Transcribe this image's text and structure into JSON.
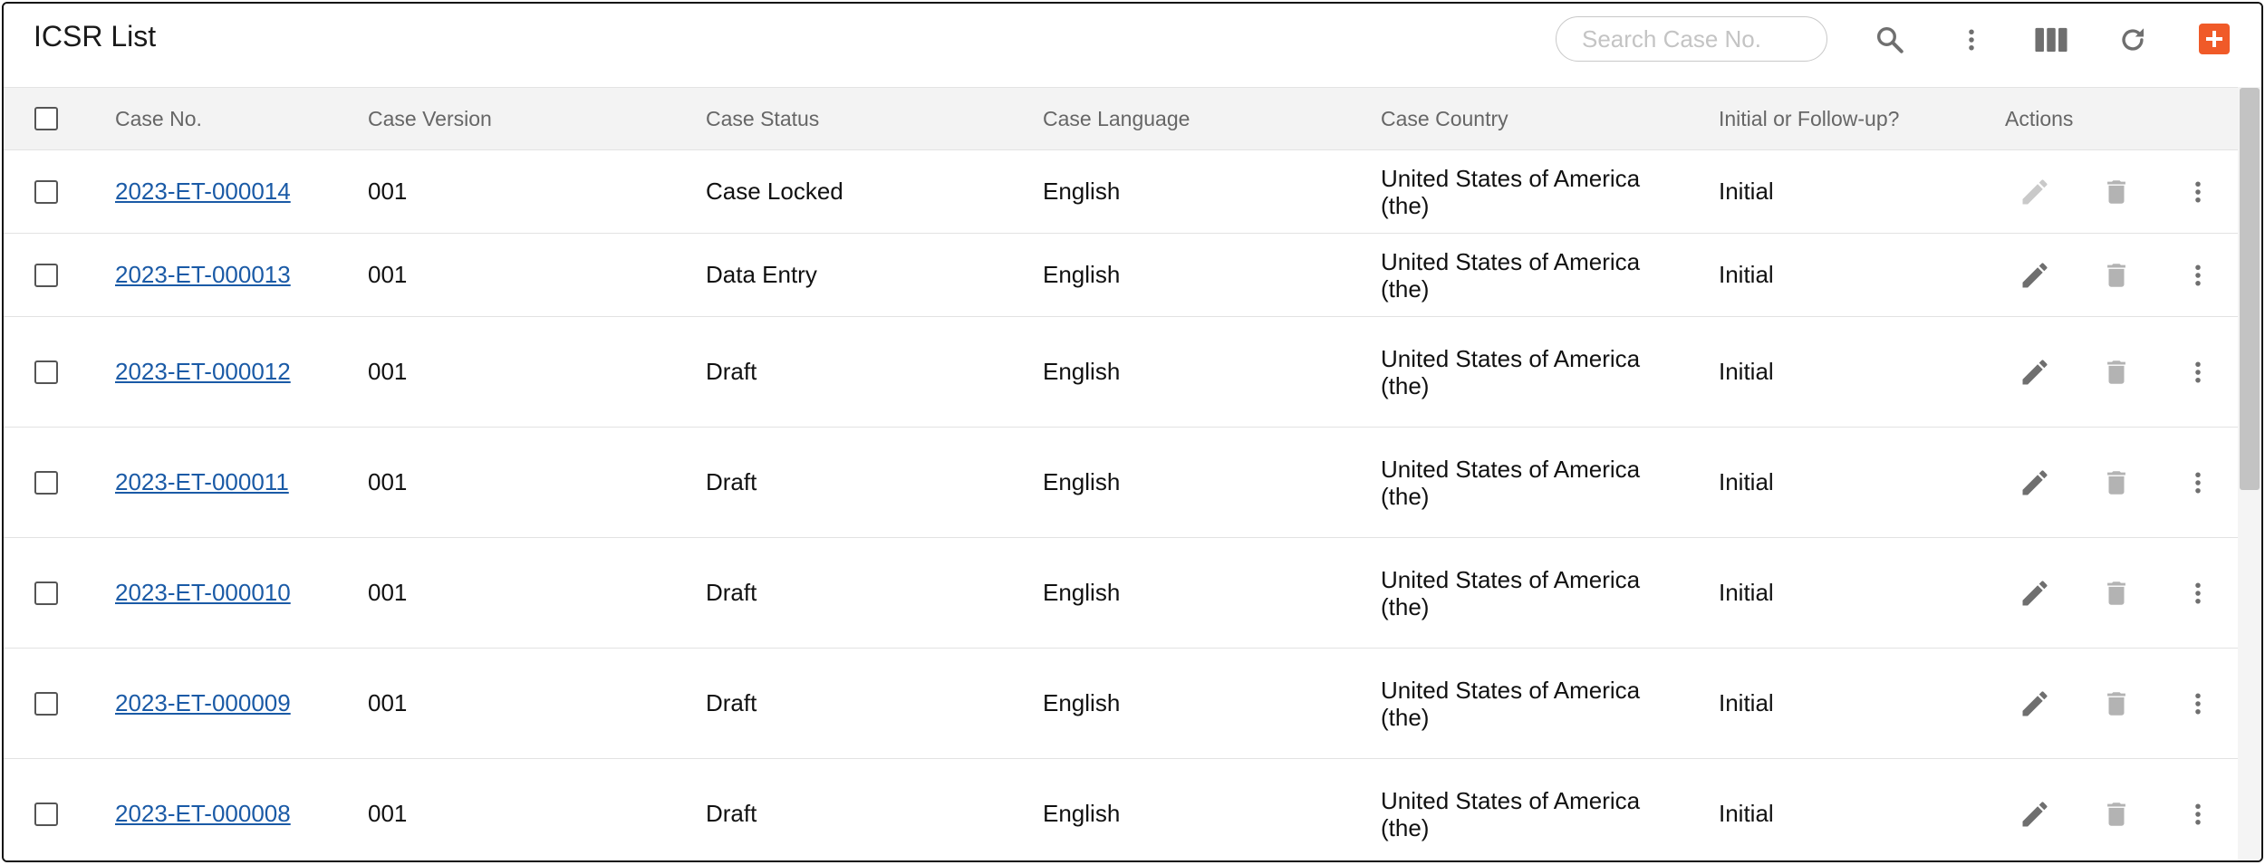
{
  "header": {
    "title": "ICSR List",
    "search_placeholder": "Search Case No."
  },
  "toolbar_icons": [
    "search-icon",
    "more-vertical-icon",
    "columns-icon",
    "refresh-icon",
    "add-icon"
  ],
  "colors": {
    "accent": "#f05a28",
    "link": "#1a5aa6",
    "header_bg": "#f3f3f3",
    "icon": "#777777"
  },
  "table": {
    "columns": [
      "Case No.",
      "Case Version",
      "Case Status",
      "Case Language",
      "Case Country",
      "Initial or Follow-up?",
      "Actions"
    ],
    "rows": [
      {
        "case_no": "2023-ET-000014",
        "version": "001",
        "status": "Case Locked",
        "language": "English",
        "country_line1": "United States of America",
        "country_line2": "(the)",
        "initial": "Initial",
        "edit_enabled": false
      },
      {
        "case_no": "2023-ET-000013",
        "version": "001",
        "status": "Data Entry",
        "language": "English",
        "country_line1": "United States of America",
        "country_line2": "(the)",
        "initial": "Initial",
        "edit_enabled": true
      },
      {
        "case_no": "2023-ET-000012",
        "version": "001",
        "status": "Draft",
        "language": "English",
        "country_line1": "United States of America",
        "country_line2": "(the)",
        "initial": "Initial",
        "edit_enabled": true
      },
      {
        "case_no": "2023-ET-000011",
        "version": "001",
        "status": "Draft",
        "language": "English",
        "country_line1": "United States of America",
        "country_line2": "(the)",
        "initial": "Initial",
        "edit_enabled": true
      },
      {
        "case_no": "2023-ET-000010",
        "version": "001",
        "status": "Draft",
        "language": "English",
        "country_line1": "United States of America",
        "country_line2": "(the)",
        "initial": "Initial",
        "edit_enabled": true
      },
      {
        "case_no": "2023-ET-000009",
        "version": "001",
        "status": "Draft",
        "language": "English",
        "country_line1": "United States of America",
        "country_line2": "(the)",
        "initial": "Initial",
        "edit_enabled": true
      },
      {
        "case_no": "2023-ET-000008",
        "version": "001",
        "status": "Draft",
        "language": "English",
        "country_line1": "United States of America",
        "country_line2": "(the)",
        "initial": "Initial",
        "edit_enabled": true
      }
    ]
  }
}
